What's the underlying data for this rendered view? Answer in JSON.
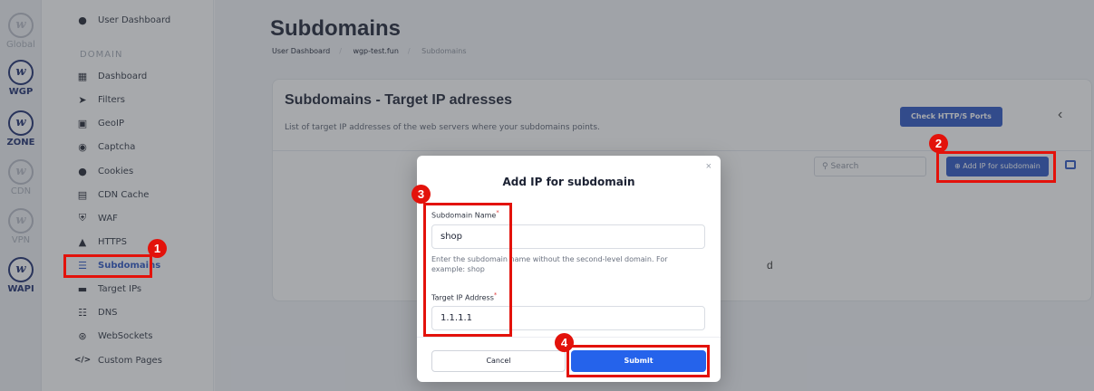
{
  "rail": {
    "items": [
      {
        "label": "Global",
        "icon": "w-logo-icon",
        "active": false
      },
      {
        "label": "WGP",
        "icon": "w-logo-icon",
        "active": true
      },
      {
        "label": "ZONE",
        "icon": "w-logo-icon",
        "active": true
      },
      {
        "label": "CDN",
        "icon": "w-logo-icon",
        "active": false
      },
      {
        "label": "VPN",
        "icon": "w-logo-icon",
        "active": false
      },
      {
        "label": "WAPI",
        "icon": "w-logo-icon",
        "active": true
      }
    ],
    "logo_letter": "w"
  },
  "sidebar": {
    "top_item": "User Dashboard",
    "section_heading": "DOMAIN",
    "items": [
      {
        "label": "Dashboard",
        "icon": "dashboard-icon"
      },
      {
        "label": "Filters",
        "icon": "filter-icon"
      },
      {
        "label": "GeoIP",
        "icon": "geoip-icon"
      },
      {
        "label": "Captcha",
        "icon": "captcha-icon"
      },
      {
        "label": "Cookies",
        "icon": "cookie-icon"
      },
      {
        "label": "CDN Cache",
        "icon": "cache-icon"
      },
      {
        "label": "WAF",
        "icon": "shield-icon"
      },
      {
        "label": "HTTPS",
        "icon": "lock-icon"
      },
      {
        "label": "Subdomains",
        "icon": "subdomains-icon",
        "active": true
      },
      {
        "label": "Target IPs",
        "icon": "server-icon"
      },
      {
        "label": "DNS",
        "icon": "dns-icon"
      },
      {
        "label": "WebSockets",
        "icon": "websocket-icon"
      },
      {
        "label": "Custom Pages",
        "icon": "code-icon"
      }
    ]
  },
  "header": {
    "title": "Subdomains",
    "breadcrumb": [
      "User Dashboard",
      "wgp-test.fun",
      "Subdomains"
    ]
  },
  "card": {
    "title": "Subdomains - Target IP adresses",
    "subtitle": "List of target IP addresses of the web servers where your subdomains points.",
    "check_button": "Check HTTP/S Ports",
    "search_placeholder": "Search",
    "add_button": "Add IP for subdomain",
    "partial_text": "d"
  },
  "modal": {
    "title": "Add IP for subdomain",
    "close": "×",
    "subdomain_label": "Subdomain Name",
    "subdomain_value": "shop",
    "help_text": "Enter the subdomain name without the second-level domain. For example: shop",
    "ip_label": "Target IP Address",
    "ip_value": "1.1.1.1",
    "required_mark": "*",
    "cancel": "Cancel",
    "submit": "Submit"
  },
  "annotations": {
    "step1": "1",
    "step2": "2",
    "step3": "3",
    "step4": "4",
    "color": "#e3120b"
  },
  "colors": {
    "primary": "#2a55c4",
    "submit": "#2563eb",
    "brand_dark": "#1a2a6c"
  }
}
